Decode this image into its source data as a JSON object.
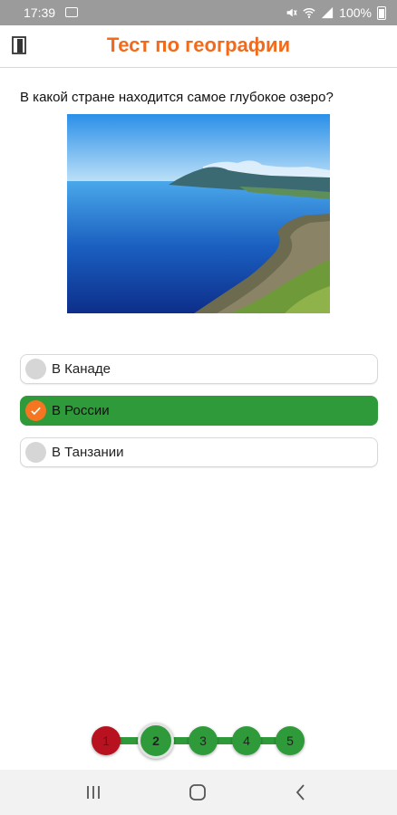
{
  "status_bar": {
    "time": "17:39",
    "battery": "100%",
    "icons": [
      "image-icon",
      "mute-icon",
      "wifi-icon",
      "signal-icon",
      "battery-icon"
    ]
  },
  "app_bar": {
    "title": "Тест по географии",
    "exit_icon": "door-exit-icon",
    "accent_color": "#f26b1d"
  },
  "question": {
    "text": "В какой стране находится самое глубокое озеро?"
  },
  "answers": [
    {
      "label": "В Канаде",
      "selected": false
    },
    {
      "label": "В России",
      "selected": true
    },
    {
      "label": "В Танзании",
      "selected": false
    }
  ],
  "progress": {
    "steps": [
      {
        "number": "1",
        "state": "wrong"
      },
      {
        "number": "2",
        "state": "current"
      },
      {
        "number": "3",
        "state": "pending"
      },
      {
        "number": "4",
        "state": "pending"
      },
      {
        "number": "5",
        "state": "pending"
      }
    ],
    "colors": {
      "correct": "#2f9a3a",
      "wrong": "#b8111f"
    }
  },
  "nav_bar": {
    "icons": [
      "recent-apps-icon",
      "home-icon",
      "back-icon"
    ]
  }
}
